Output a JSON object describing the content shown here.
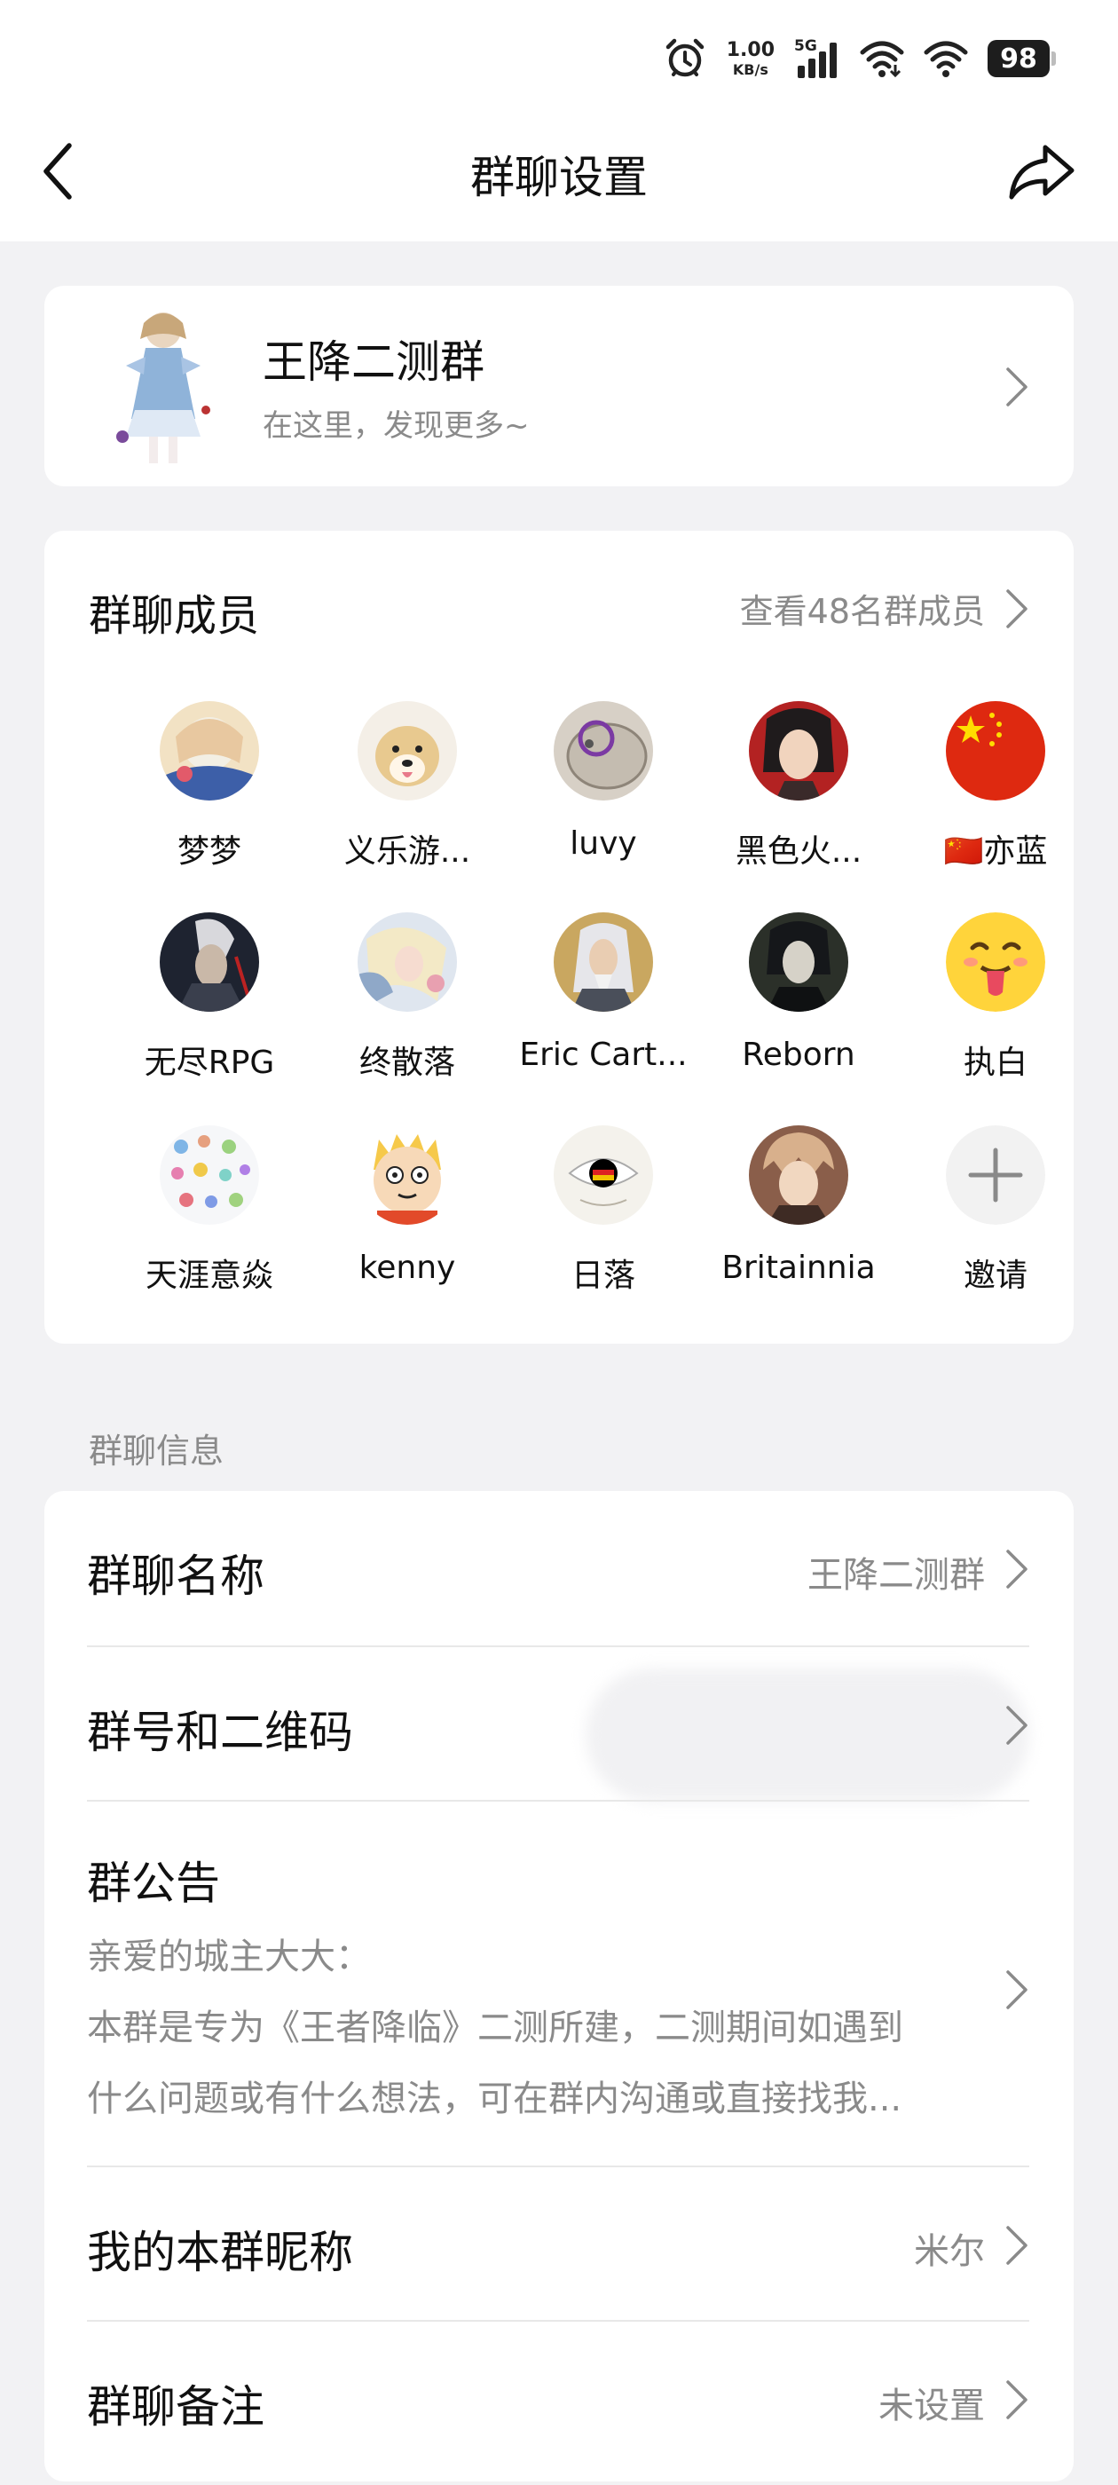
{
  "status_bar": {
    "speed_value": "1.00",
    "speed_unit": "KB/s",
    "network": "5G",
    "battery": "98",
    "icons": [
      "alarm-icon",
      "signal-icon",
      "wifi-icon",
      "wifi-icon",
      "battery-icon"
    ]
  },
  "nav": {
    "title": "群聊设置",
    "back_icon": "chevron-left-icon",
    "share_icon": "share-icon"
  },
  "group": {
    "name": "王降二测群",
    "subtitle": "在这里，发现更多~"
  },
  "members": {
    "title": "群聊成员",
    "view_all": "查看48名群成员",
    "list": [
      {
        "name": "梦梦",
        "color": "#e8c8a0"
      },
      {
        "name": "义乐游...",
        "color": "#e9dccb"
      },
      {
        "name": "luvy",
        "color": "#cfc7bd"
      },
      {
        "name": "黑色火...",
        "color": "#8c1d1d"
      },
      {
        "name": "🇨🇳亦蓝",
        "color": "#de2910"
      },
      {
        "name": "无尽RPG",
        "color": "#2a2f3a"
      },
      {
        "name": "终散落",
        "color": "#c9d3e0"
      },
      {
        "name": "Eric Cart...",
        "color": "#b89a5a"
      },
      {
        "name": "Reborn",
        "color": "#2b3029"
      },
      {
        "name": "执白",
        "color": "#ffd43b"
      },
      {
        "name": "天涯意焱",
        "color": "#eef0f3"
      },
      {
        "name": "kenny",
        "color": "#f6c94a"
      },
      {
        "name": "日落",
        "color": "#f2efe8"
      },
      {
        "name": "Britainnia",
        "color": "#a87a62"
      },
      {
        "name": "邀请",
        "color": "#f2f2f2"
      }
    ]
  },
  "info_section": {
    "label": "群聊信息",
    "name_row": {
      "title": "群聊名称",
      "value": "王降二测群"
    },
    "qr_row": {
      "title": "群号和二维码"
    },
    "notice_row": {
      "title": "群公告",
      "line1": "亲爱的城主大大：",
      "line2": "本群是专为《王者降临》二测所建，二测期间如遇到",
      "line3": "什么问题或有什么想法，可在群内沟通或直接找我..."
    },
    "nickname_row": {
      "title": "我的本群昵称",
      "value": "米尔"
    },
    "remark_row": {
      "title": "群聊备注",
      "value": "未设置"
    }
  }
}
